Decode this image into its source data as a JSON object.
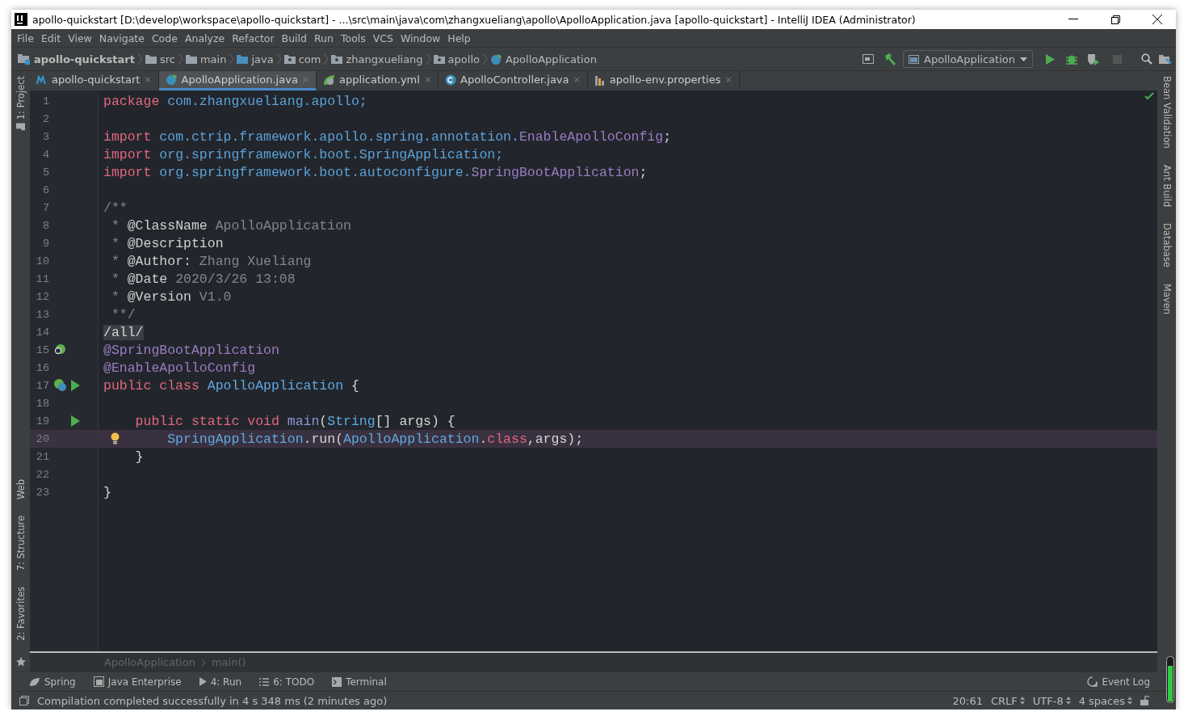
{
  "window": {
    "title": "apollo-quickstart [D:\\develop\\workspace\\apollo-quickstart] - ...\\src\\main\\java\\com\\zhangxueliang\\apollo\\ApolloApplication.java [apollo-quickstart] - IntelliJ IDEA (Administrator)"
  },
  "menu": [
    "File",
    "Edit",
    "View",
    "Navigate",
    "Code",
    "Analyze",
    "Refactor",
    "Build",
    "Run",
    "Tools",
    "VCS",
    "Window",
    "Help"
  ],
  "navigation": [
    {
      "label": "apollo-quickstart",
      "kind": "project"
    },
    {
      "label": "src",
      "kind": "folder"
    },
    {
      "label": "main",
      "kind": "folder"
    },
    {
      "label": "java",
      "kind": "source"
    },
    {
      "label": "com",
      "kind": "package"
    },
    {
      "label": "zhangxueliang",
      "kind": "package"
    },
    {
      "label": "apollo",
      "kind": "package"
    },
    {
      "label": "ApolloApplication",
      "kind": "class"
    }
  ],
  "run_configuration": "ApolloApplication",
  "tabs": [
    {
      "label": "apollo-quickstart",
      "kind": "maven",
      "close": "×",
      "selected": false
    },
    {
      "label": "ApolloApplication.java",
      "kind": "spring-class",
      "close": "×",
      "selected": true
    },
    {
      "label": "application.yml",
      "kind": "spring",
      "close": "×",
      "selected": false
    },
    {
      "label": "ApolloController.java",
      "kind": "class",
      "close": "×",
      "selected": false
    },
    {
      "label": "apollo-env.properties",
      "kind": "properties",
      "close": "×",
      "selected": false
    }
  ],
  "left_tools_top": [
    "1: Project"
  ],
  "left_tools_bottom": [
    "Web",
    "7: Structure",
    "2: Favorites"
  ],
  "right_tools": [
    "Bean Validation",
    "Ant Build",
    "Database",
    "Maven"
  ],
  "code": [
    {
      "number": "1",
      "kind": "plain",
      "tokens": [
        {
          "text": "package",
          "kind": "keyword"
        },
        {
          "text": " com.zhangxueliang.apollo;",
          "kind": "pkg"
        }
      ]
    },
    {
      "number": "2",
      "kind": "plain"
    },
    {
      "number": "3",
      "kind": "plain",
      "tokens": [
        {
          "text": "import",
          "kind": "keyword"
        },
        {
          "text": " com.ctrip.framework.apollo.spring.annotation.",
          "kind": "pkg"
        },
        {
          "text": "EnableApolloConfig",
          "kind": "annotation"
        },
        {
          "text": ";",
          "kind": "plain"
        }
      ]
    },
    {
      "number": "4",
      "kind": "plain",
      "tokens": [
        {
          "text": "import",
          "kind": "keyword"
        },
        {
          "text": " org.springframework.boot.SpringApplication;",
          "kind": "pkg"
        }
      ]
    },
    {
      "number": "5",
      "kind": "plain",
      "tokens": [
        {
          "text": "import",
          "kind": "keyword"
        },
        {
          "text": " org.springframework.boot.autoconfigure.",
          "kind": "pkg"
        },
        {
          "text": "SpringBootApplication",
          "kind": "annotation"
        },
        {
          "text": ";",
          "kind": "plain"
        }
      ]
    },
    {
      "number": "6",
      "kind": "plain"
    },
    {
      "number": "7",
      "kind": "plain",
      "tokens": [
        {
          "text": "/**",
          "kind": "comment"
        }
      ]
    },
    {
      "number": "8",
      "kind": "plain",
      "tokens": [
        {
          "text": " * ",
          "kind": "comment"
        },
        {
          "text": "@ClassName",
          "kind": "doctag"
        },
        {
          "text": " ApolloApplication",
          "kind": "comment"
        }
      ]
    },
    {
      "number": "9",
      "kind": "plain",
      "tokens": [
        {
          "text": " * ",
          "kind": "comment"
        },
        {
          "text": "@Description",
          "kind": "doctag"
        }
      ]
    },
    {
      "number": "10",
      "kind": "plain",
      "tokens": [
        {
          "text": " * ",
          "kind": "comment"
        },
        {
          "text": "@Author:",
          "kind": "doctag"
        },
        {
          "text": " Zhang Xueliang",
          "kind": "comment"
        }
      ]
    },
    {
      "number": "11",
      "kind": "plain",
      "tokens": [
        {
          "text": " * ",
          "kind": "comment"
        },
        {
          "text": "@Date",
          "kind": "doctag"
        },
        {
          "text": " 2020/3/26 13:08",
          "kind": "comment"
        }
      ]
    },
    {
      "number": "12",
      "kind": "plain",
      "tokens": [
        {
          "text": " * ",
          "kind": "comment"
        },
        {
          "text": "@Version",
          "kind": "doctag"
        },
        {
          "text": " V1.0",
          "kind": "comment"
        }
      ]
    },
    {
      "number": "13",
      "kind": "plain",
      "tokens": [
        {
          "text": " **/",
          "kind": "comment"
        }
      ]
    },
    {
      "number": "14",
      "kind": "plain",
      "tokens": [
        {
          "text": "/all/",
          "kind": "highlight"
        }
      ]
    },
    {
      "number": "15",
      "kind": "bean",
      "tokens": [
        {
          "text": "@SpringBootApplication",
          "kind": "annotation"
        }
      ]
    },
    {
      "number": "16",
      "kind": "plain",
      "tokens": [
        {
          "text": "@EnableApolloConfig",
          "kind": "annotation"
        }
      ]
    },
    {
      "number": "17",
      "kind": "bean-run",
      "tokens": [
        {
          "text": "public class",
          "kind": "keyword"
        },
        {
          "text": " ApolloApplication",
          "kind": "type"
        },
        {
          "text": " {",
          "kind": "plain"
        }
      ]
    },
    {
      "number": "18",
      "kind": "plain"
    },
    {
      "number": "19",
      "kind": "run",
      "tokens": [
        {
          "text": "    public static void",
          "kind": "keyword"
        },
        {
          "text": " main",
          "kind": "method"
        },
        {
          "text": "(",
          "kind": "plain"
        },
        {
          "text": "String",
          "kind": "type"
        },
        {
          "text": "[] args) {",
          "kind": "plain"
        }
      ]
    },
    {
      "number": "20",
      "kind": "bulb",
      "current": true,
      "tokens": [
        {
          "text": "        SpringApplication",
          "kind": "type"
        },
        {
          "text": ".run(",
          "kind": "plain"
        },
        {
          "text": "ApolloApplication",
          "kind": "type"
        },
        {
          "text": ".",
          "kind": "plain"
        },
        {
          "text": "class",
          "kind": "keyword"
        },
        {
          "text": ",args);",
          "kind": "plain"
        }
      ]
    },
    {
      "number": "21",
      "kind": "plain",
      "tokens": [
        {
          "text": "    }",
          "kind": "plain"
        }
      ]
    },
    {
      "number": "22",
      "kind": "plain"
    },
    {
      "number": "23",
      "kind": "plain",
      "tokens": [
        {
          "text": "}",
          "kind": "plain"
        }
      ]
    }
  ],
  "code_breadcrumb": [
    "ApolloApplication",
    "main()"
  ],
  "bottom_tools": [
    {
      "label": "Spring",
      "kind": "spring"
    },
    {
      "label": "Java Enterprise",
      "kind": "enterprise"
    },
    {
      "label": "4: Run",
      "kind": "run"
    },
    {
      "label": "6: TODO",
      "kind": "todo"
    },
    {
      "label": "Terminal",
      "kind": "terminal"
    }
  ],
  "event_log": "Event Log",
  "status": {
    "message": "Compilation completed successfully in 4 s 348 ms (2 minutes ago)",
    "position": "20:61",
    "selectors": [
      "CRLF",
      "UTF-8",
      "4 spaces"
    ]
  }
}
